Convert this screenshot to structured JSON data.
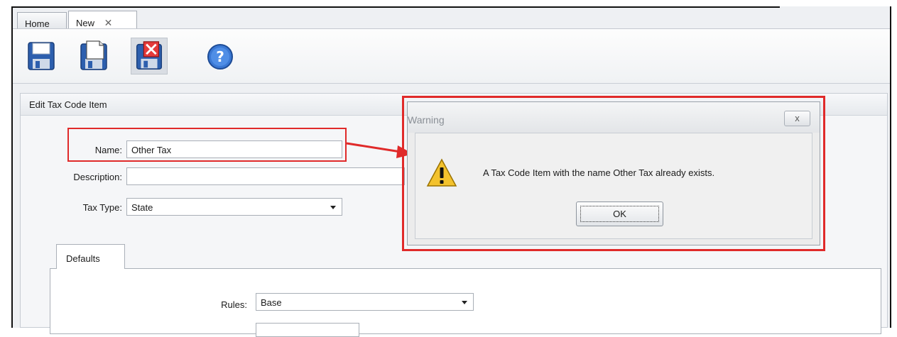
{
  "tabs": [
    {
      "label": "Home",
      "active": false
    },
    {
      "label": "New",
      "active": true,
      "close_glyph": "✕"
    }
  ],
  "toolbar": {
    "buttons": [
      {
        "icon": "floppy-save-icon"
      },
      {
        "icon": "floppy-save-new-icon"
      },
      {
        "icon": "floppy-save-close-icon"
      },
      {
        "icon": "help-icon"
      }
    ]
  },
  "form": {
    "title": "Edit Tax Code Item",
    "name_label": "Name:",
    "name_value": "Other Tax",
    "description_label": "Description:",
    "description_value": "",
    "tax_type_label": "Tax Type:",
    "tax_type_value": "State",
    "subtab_label": "Defaults",
    "rules_label": "Rules:",
    "rules_value": "Base"
  },
  "dialog": {
    "title": "Warning",
    "close_glyph": "x",
    "message": "A Tax Code Item with the name Other Tax already exists.",
    "ok_label": "OK",
    "icon": "warning-icon"
  },
  "colors": {
    "highlight": "#e02a2a",
    "accent_blue": "#2f6fc7"
  }
}
